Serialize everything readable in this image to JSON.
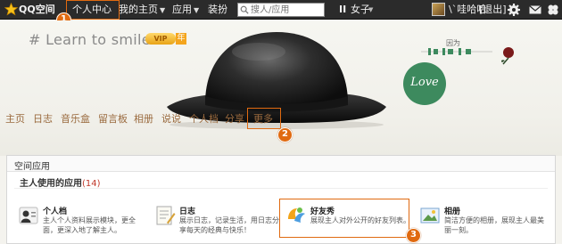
{
  "topbar": {
    "brand": "QQ空间",
    "personal_center": "个人中心",
    "my_home": "我的主页",
    "apps": "应用",
    "decorate": "装扮",
    "search_placeholder": "搜人/应用",
    "music_label": "II",
    "music_title": "女子",
    "user_name": "\\`哇哈哈",
    "logout": "[退出]"
  },
  "banner": {
    "blog_title": "# Learn to smile",
    "vip_label": "VIP",
    "vip_year": "年",
    "deco_text": "因为",
    "love_text": "Love"
  },
  "nav": {
    "items": [
      "主页",
      "日志",
      "音乐盒",
      "留言板",
      "相册",
      "说说",
      "个人档",
      "分享",
      "更多"
    ]
  },
  "steps": [
    "1",
    "2",
    "3"
  ],
  "panel": {
    "title": "空间应用",
    "subtitle": "主人使用的应用",
    "count": "(14)",
    "apps": [
      {
        "name": "个人档",
        "desc": "主人个人资料展示模块，更全面，更深入地了解主人。",
        "icon": "profile-icon"
      },
      {
        "name": "日志",
        "desc": "展示日志，记录生活，用日志分享每天的经典与快乐！",
        "icon": "blog-icon"
      },
      {
        "name": "好友秀",
        "desc": "展现主人对外公开的好友列表。",
        "icon": "friends-icon"
      },
      {
        "name": "相册",
        "desc": "简洁方便的相册，展现主人最美丽一刻。",
        "icon": "photo-icon"
      }
    ]
  },
  "colors": {
    "highlight": "#e06a10",
    "topbar_bg": "#2b2b2b",
    "nav_text": "#9a6a3e",
    "love_green": "#3d8a5e"
  }
}
